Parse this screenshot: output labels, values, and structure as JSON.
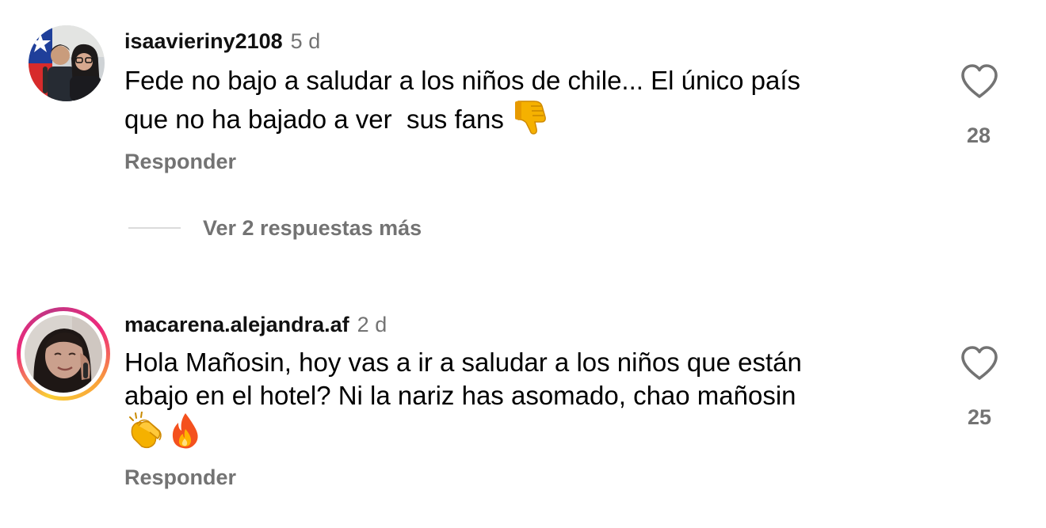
{
  "comments": [
    {
      "username": "isaavieriny2108",
      "time": "5 d",
      "text_lines": [
        "Fede no bajo a saludar a los niños de chile... El único país",
        "que no ha bajado a ver  sus fans"
      ],
      "trailing_emojis": [
        "thumbs-down-emoji"
      ],
      "like_count": "28",
      "reply_label": "Responder",
      "has_story_ring": false
    },
    {
      "username": "macarena.alejandra.af",
      "time": "2 d",
      "text_lines": [
        "Hola Mañosin, hoy vas a ir a saludar a los niños que están",
        "abajo en el hotel? Ni la nariz has asomado, chao mañosin"
      ],
      "trailing_emojis": [
        "clapping-hands-emoji",
        "fire-emoji"
      ],
      "like_count": "25",
      "reply_label": "Responder",
      "has_story_ring": true
    }
  ],
  "view_more_replies": "Ver 2 respuestas más",
  "icons": {
    "like": "heart-outline-icon"
  },
  "colors": {
    "secondary_text": "#737373",
    "divider": "#dbdbdb",
    "story_ring_start": "#f9ce34",
    "story_ring_mid": "#ee2a7b"
  }
}
